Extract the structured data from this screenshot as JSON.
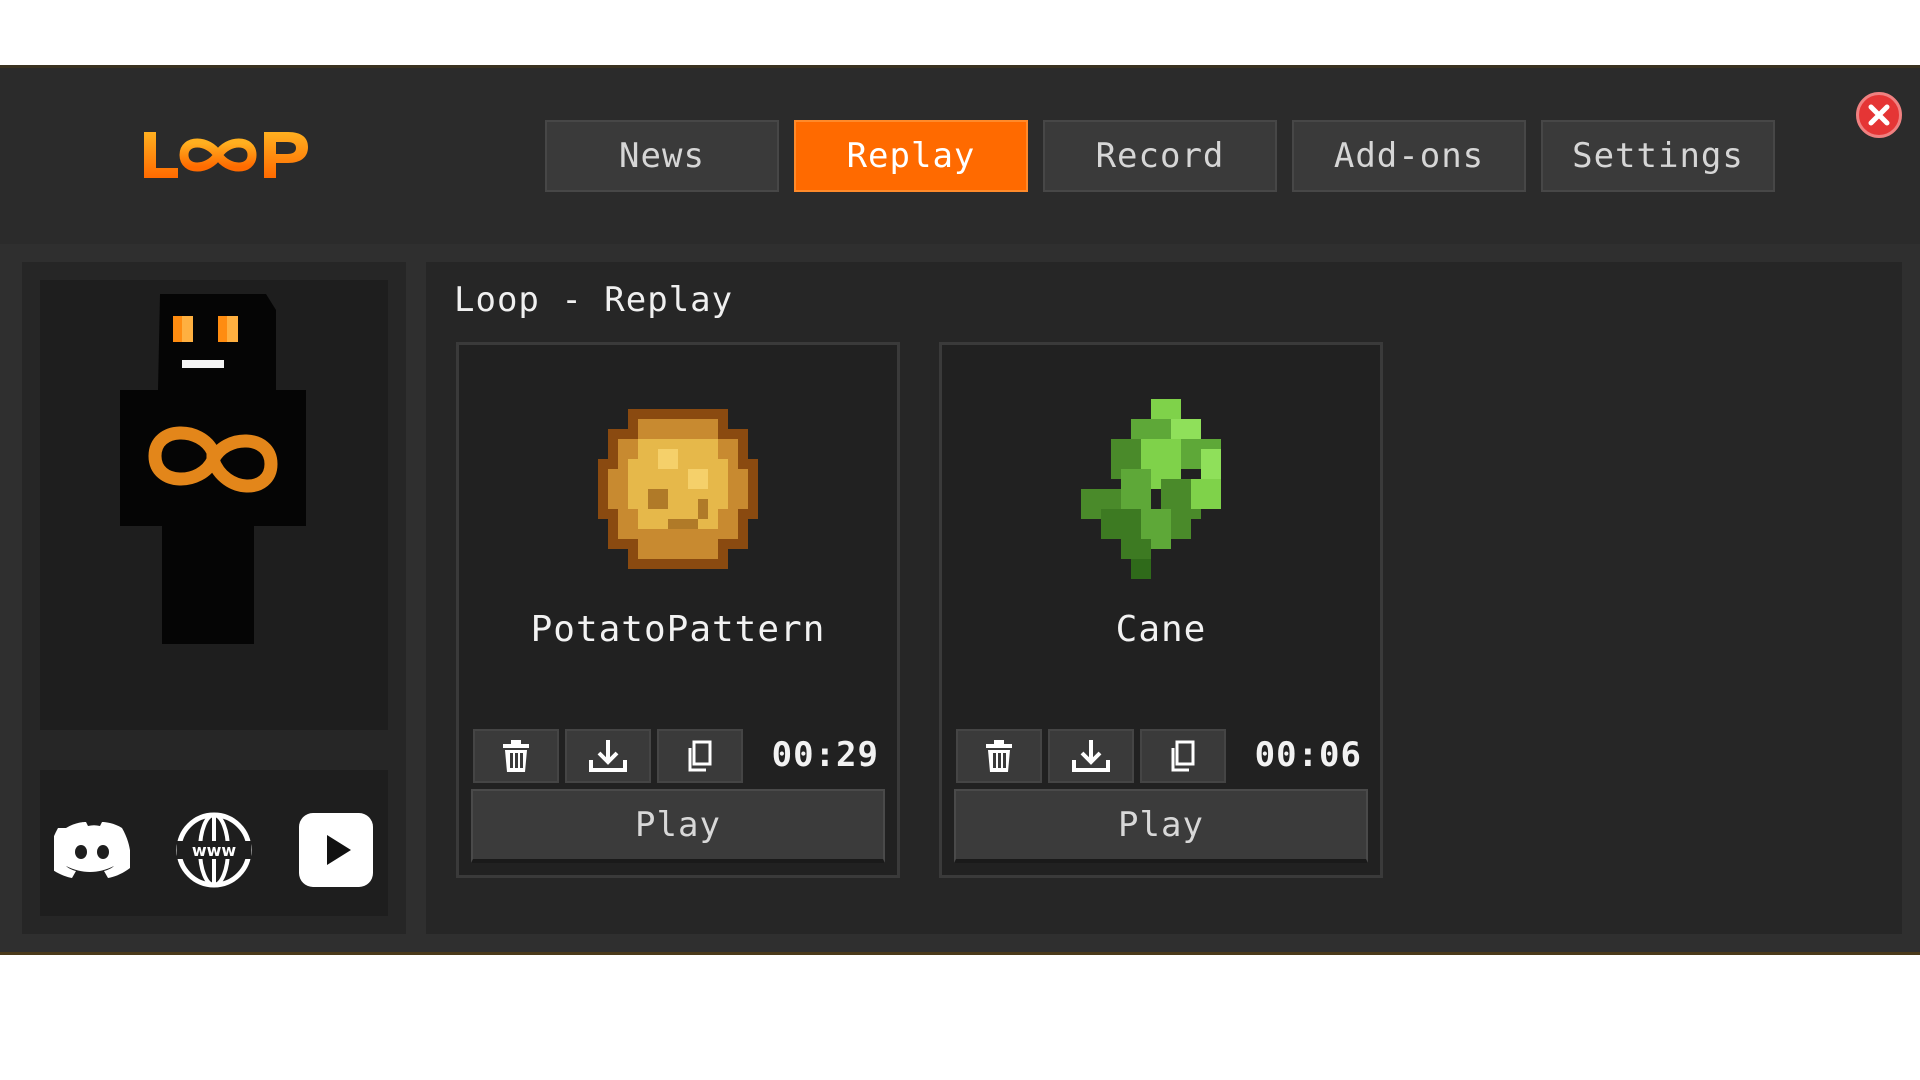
{
  "app": {
    "logo_text": "LOOP"
  },
  "tabs": [
    {
      "label": "News",
      "active": false
    },
    {
      "label": "Replay",
      "active": true
    },
    {
      "label": "Record",
      "active": false
    },
    {
      "label": "Add-ons",
      "active": false
    },
    {
      "label": "Settings",
      "active": false
    }
  ],
  "colors": {
    "accent": "#ff6a00",
    "close": "#e53535",
    "panel": "#262626"
  },
  "sidebar": {
    "social": [
      {
        "icon": "discord-icon"
      },
      {
        "icon": "website-icon"
      },
      {
        "icon": "youtube-icon"
      }
    ]
  },
  "main": {
    "title": "Loop - Replay",
    "replays": [
      {
        "name": "PotatoPattern",
        "duration": "00:29",
        "icon": "potato-icon",
        "play_label": "Play"
      },
      {
        "name": "Cane",
        "duration": "00:06",
        "icon": "sugar-cane-icon",
        "play_label": "Play"
      }
    ]
  }
}
